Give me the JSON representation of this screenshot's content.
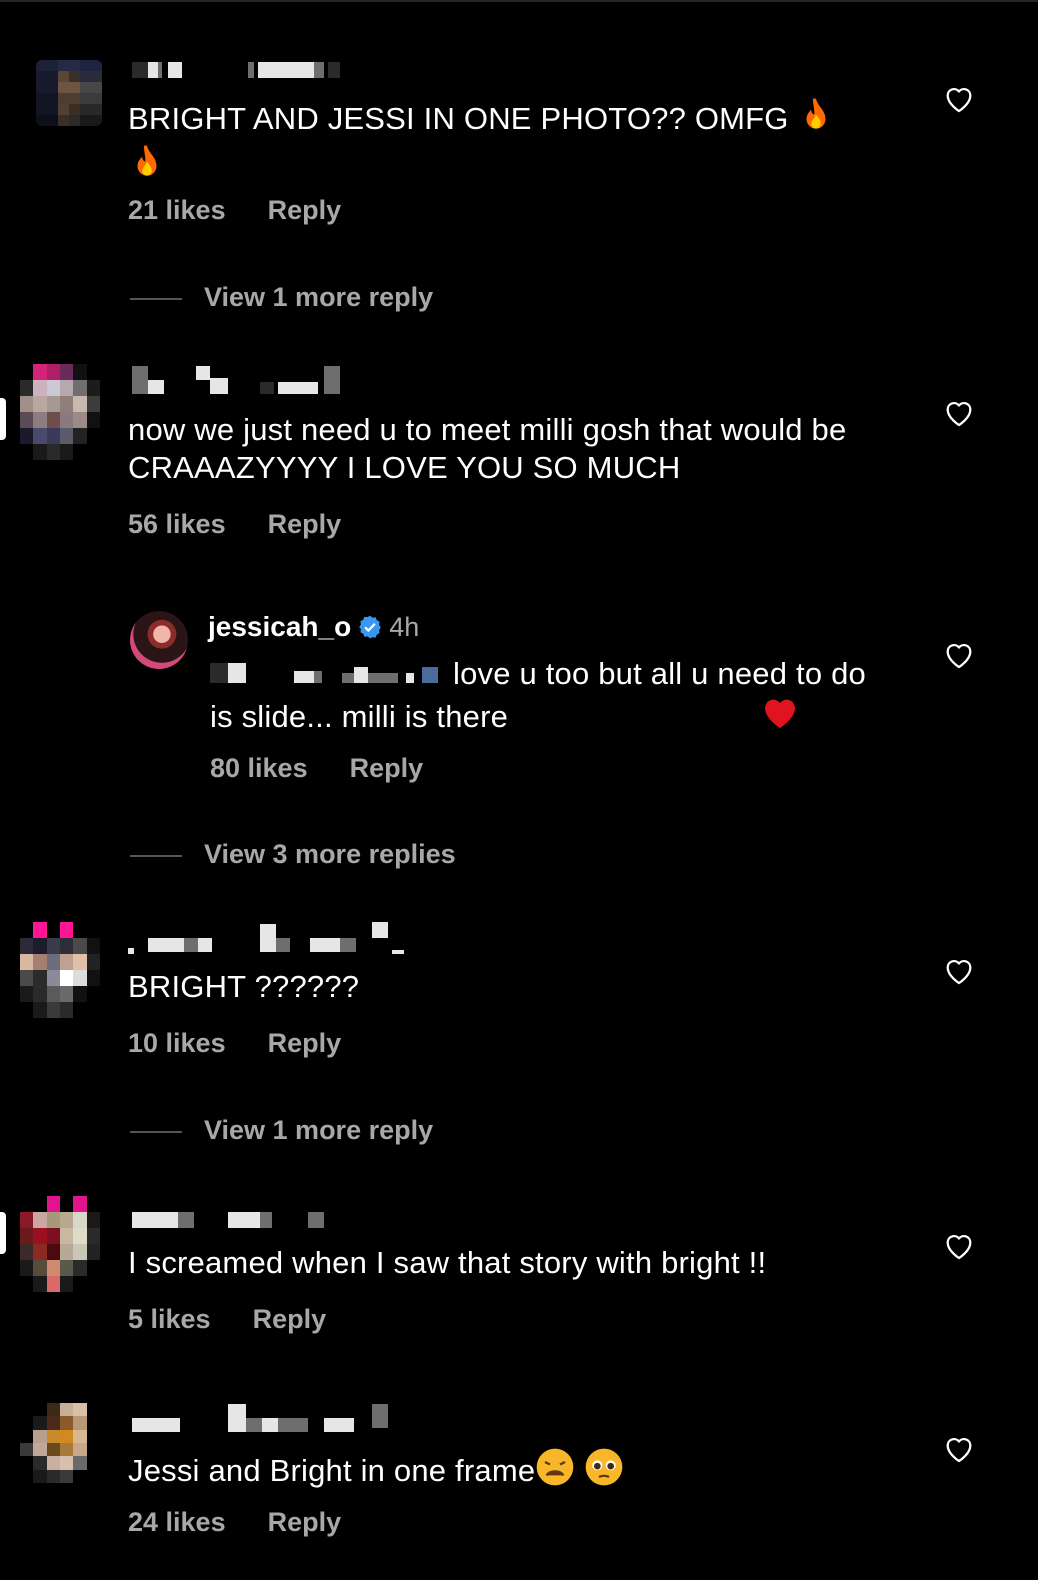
{
  "comments": [
    {
      "text": "BRIGHT AND JESSI IN ONE PHOTO?? OMFG",
      "emojis": [
        "fire",
        "fire"
      ],
      "likes": "21 likes",
      "reply_label": "Reply",
      "view_more": "View 1 more reply"
    },
    {
      "text": "now we just need u to meet milli gosh that would be CRAAAZYYYY I LOVE YOU SO MUCH",
      "likes": "56 likes",
      "reply_label": "Reply",
      "reply": {
        "username": "jessicah_o",
        "time": "4h",
        "text": "love u too but all u need to do is slide... milli is there",
        "emoji": "red-heart",
        "likes": "80 likes",
        "reply_label": "Reply"
      },
      "view_more": "View 3 more replies"
    },
    {
      "text": "BRIGHT ??????",
      "likes": "10 likes",
      "reply_label": "Reply",
      "view_more": "View 1 more reply"
    },
    {
      "text": "I screamed when I saw that story with bright !!",
      "likes": "5 likes",
      "reply_label": "Reply"
    },
    {
      "text": "Jessi and Bright in one frame",
      "emojis": [
        "weary-face",
        "pleading-face"
      ],
      "likes": "24 likes",
      "reply_label": "Reply"
    }
  ],
  "colors": {
    "background": "#000000",
    "secondary_text": "#a8a8a8",
    "verified_blue": "#3897f0",
    "heart_outline": "#ffffff"
  },
  "icons": [
    "heart-outline-icon",
    "verified-badge-icon"
  ]
}
